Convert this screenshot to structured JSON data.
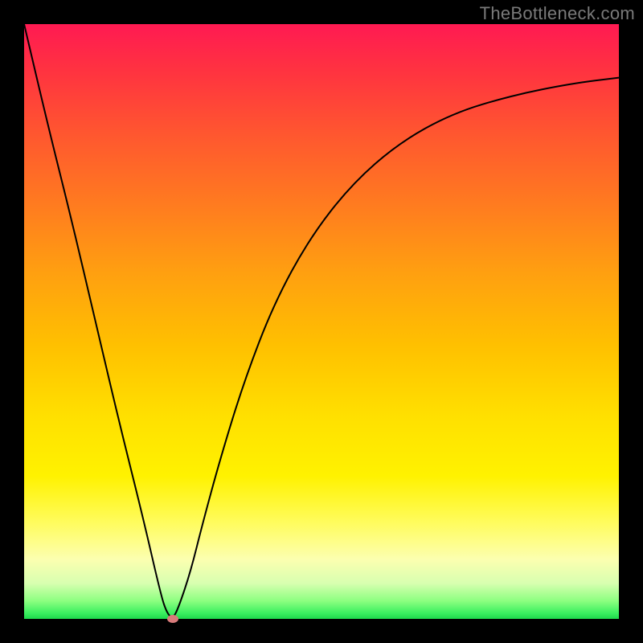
{
  "watermark": "TheBottleneck.com",
  "chart_data": {
    "type": "line",
    "title": "",
    "xlabel": "",
    "ylabel": "",
    "xlim": [
      0,
      100
    ],
    "ylim": [
      0,
      100
    ],
    "background": "rainbow-gradient-red-to-green",
    "series": [
      {
        "name": "bottleneck-curve",
        "x": [
          0,
          4,
          8,
          12,
          16,
          20,
          23,
          24,
          25,
          26,
          28,
          30,
          33,
          37,
          42,
          48,
          55,
          63,
          72,
          82,
          92,
          100
        ],
        "values": [
          100,
          83,
          67,
          50,
          33,
          17,
          4,
          1,
          0,
          2,
          8,
          16,
          27,
          40,
          53,
          64,
          73,
          80,
          85,
          88,
          90,
          91
        ]
      }
    ],
    "marker": {
      "name": "min-point",
      "x": 25,
      "y": 0,
      "color": "#d87a7a"
    }
  }
}
